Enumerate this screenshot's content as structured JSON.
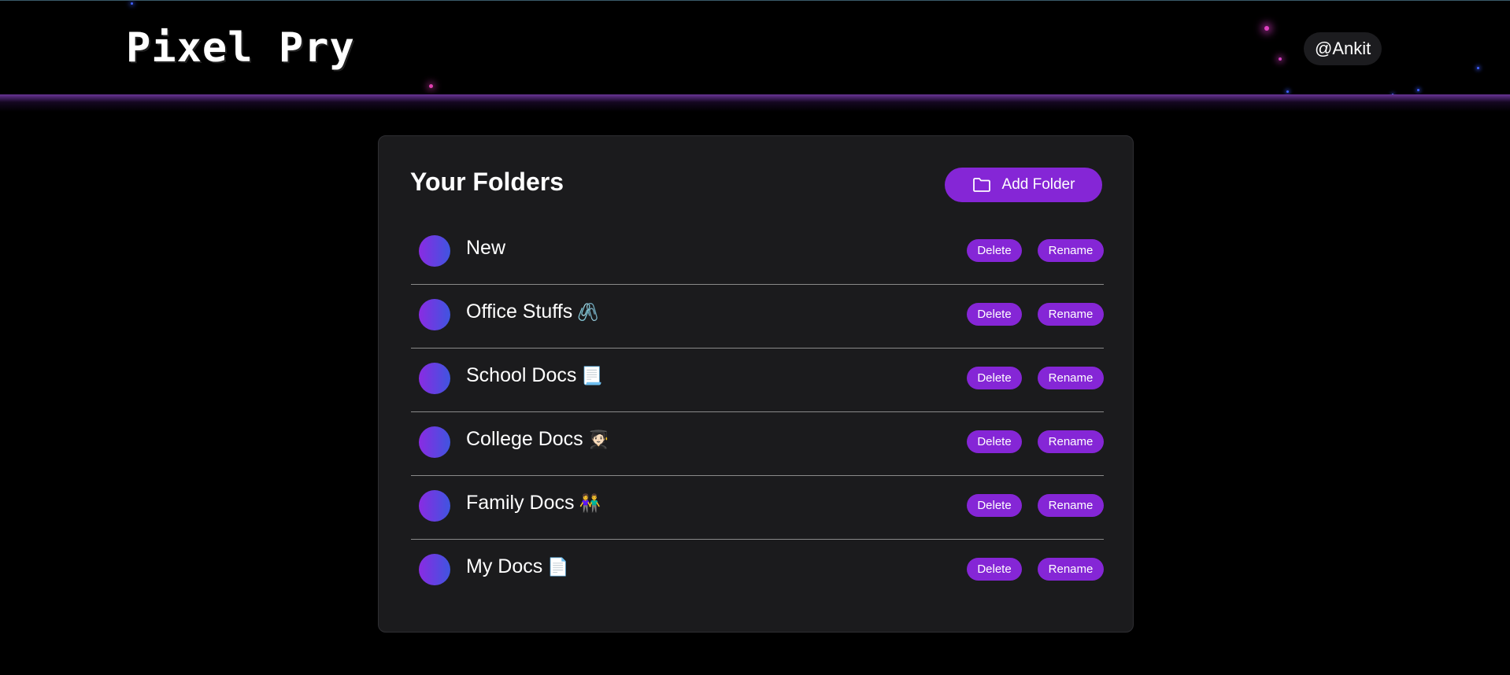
{
  "header": {
    "logo": "Pixel Pry",
    "user": "@Ankit"
  },
  "panel": {
    "title": "Your Folders",
    "add_button_label": "Add Folder"
  },
  "folders": [
    {
      "name": "New",
      "emoji": "",
      "delete_label": "Delete",
      "rename_label": "Rename"
    },
    {
      "name": "Office Stuffs",
      "emoji": "🖇️",
      "delete_label": "Delete",
      "rename_label": "Rename"
    },
    {
      "name": "School Docs",
      "emoji": "📃",
      "delete_label": "Delete",
      "rename_label": "Rename"
    },
    {
      "name": "College Docs",
      "emoji": "🧑🏻‍🎓",
      "delete_label": "Delete",
      "rename_label": "Rename"
    },
    {
      "name": "Family Docs",
      "emoji": "👫",
      "delete_label": "Delete",
      "rename_label": "Rename"
    },
    {
      "name": "My Docs",
      "emoji": "📄",
      "delete_label": "Delete",
      "rename_label": "Rename"
    }
  ],
  "colors": {
    "accent": "#8526d6",
    "panel_bg": "#1b1b1d",
    "page_bg": "#000000"
  }
}
